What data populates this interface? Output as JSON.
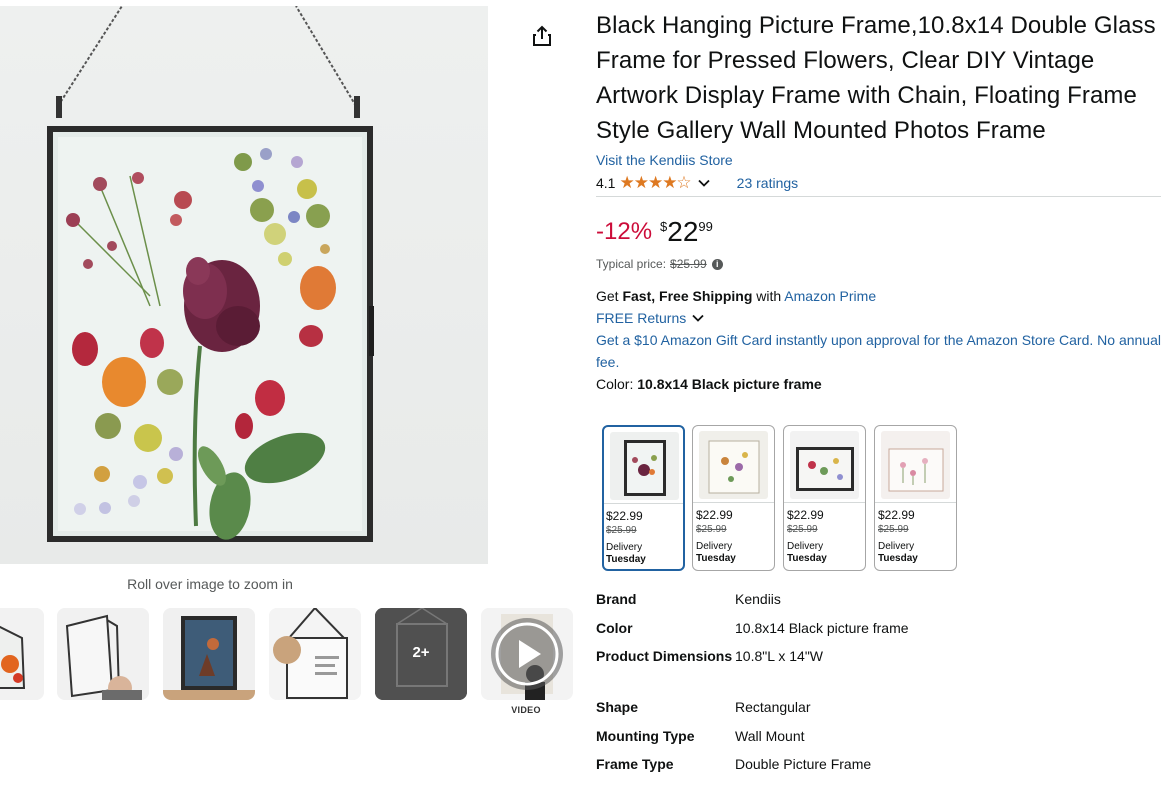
{
  "product": {
    "title": "Black Hanging Picture Frame,10.8x14 Double Glass Frame for Pressed Flowers, Clear DIY Vintage Artwork Display Frame with Chain, Floating Frame Style Gallery Wall Mounted Photos Frame",
    "store_link": "Visit the Kendiis Store",
    "rating": "4.1",
    "ratings_count": "23 ratings",
    "stars_filled": 4,
    "stars_text": "★★★★☆"
  },
  "media": {
    "zoom_hint": "Roll over image to zoom in",
    "more_label": "2+",
    "video_label": "VIDEO"
  },
  "pricing": {
    "discount": "-12%",
    "currency_symbol": "$",
    "price_whole": "22",
    "price_fraction": "99",
    "typical_label": "Typical price:",
    "typical_price": "$25.99",
    "info_glyph": "i"
  },
  "shipping": {
    "get": "Get",
    "fast_free": "Fast, Free Shipping",
    "with": "with",
    "prime_link": "Amazon Prime",
    "returns_link": "FREE Returns",
    "gift_card": "Get a $10 Amazon Gift Card instantly upon approval for the Amazon Store Card. No annual fee."
  },
  "color": {
    "label": "Color:",
    "selected": "10.8x14 Black picture frame"
  },
  "swatches": [
    {
      "price": "$22.99",
      "old_price": "$25.99",
      "delivery": "Delivery",
      "day": "Tuesday"
    },
    {
      "price": "$22.99",
      "old_price": "$25.99",
      "delivery": "Delivery",
      "day": "Tuesday"
    },
    {
      "price": "$22.99",
      "old_price": "$25.99",
      "delivery": "Delivery",
      "day": "Tuesday"
    },
    {
      "price": "$22.99",
      "old_price": "$25.99",
      "delivery": "Delivery",
      "day": "Tuesday"
    }
  ],
  "specs": [
    {
      "key": "Brand",
      "value": "Kendiis"
    },
    {
      "key": "Color",
      "value": "10.8x14 Black picture frame"
    },
    {
      "key": "Product Dimensions",
      "value": "10.8\"L x 14\"W"
    },
    {
      "key": "Shape",
      "value": "Rectangular"
    },
    {
      "key": "Mounting Type",
      "value": "Wall Mount"
    },
    {
      "key": "Frame Type",
      "value": "Double Picture Frame"
    }
  ],
  "colors": {
    "link": "#2162a1",
    "discount": "#cc0c39",
    "star": "#de7921",
    "text": "#0f1111",
    "muted": "#565959"
  }
}
